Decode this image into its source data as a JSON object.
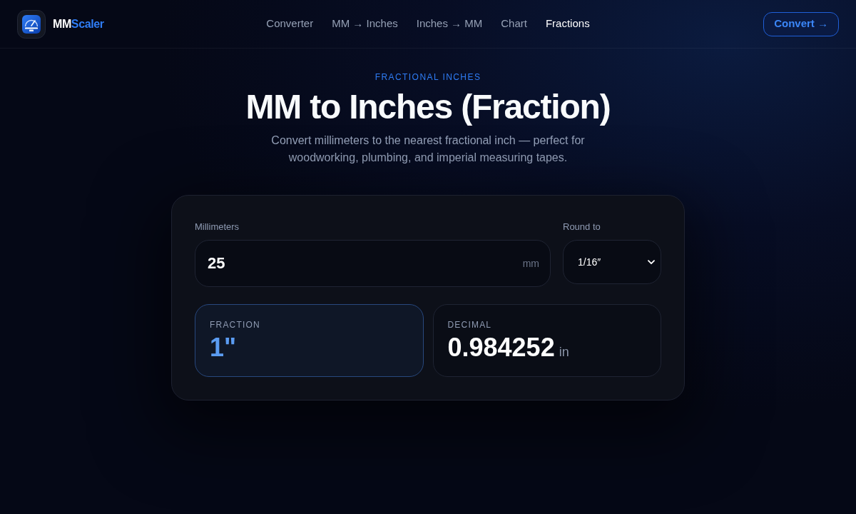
{
  "brand": {
    "prefix": "MM",
    "name": "Scaler"
  },
  "nav": [
    {
      "label": "Converter",
      "selected": false
    },
    {
      "label": "MM → Inches",
      "selected": false
    },
    {
      "label": "Inches → MM",
      "selected": false
    },
    {
      "label": "Chart",
      "selected": false
    },
    {
      "label": "Fractions",
      "selected": true
    }
  ],
  "cta_button": {
    "label": "Convert →"
  },
  "hero": {
    "eyebrow": "FRACTIONAL INCHES",
    "title": "MM to Inches (Fraction)",
    "subtitle": "Convert millimeters to the nearest fractional inch — perfect for woodworking, plumbing, and imperial measuring tapes."
  },
  "converter": {
    "millimeters": {
      "label": "Millimeters",
      "value": "25",
      "unit": "mm"
    },
    "round_to": {
      "label": "Round to",
      "value": "1/16″"
    },
    "results": [
      {
        "label": "FRACTION",
        "value": "1\"",
        "highlighted": true
      },
      {
        "label": "DECIMAL",
        "value": "0.984252",
        "unit": "in",
        "highlighted": false
      }
    ]
  }
}
